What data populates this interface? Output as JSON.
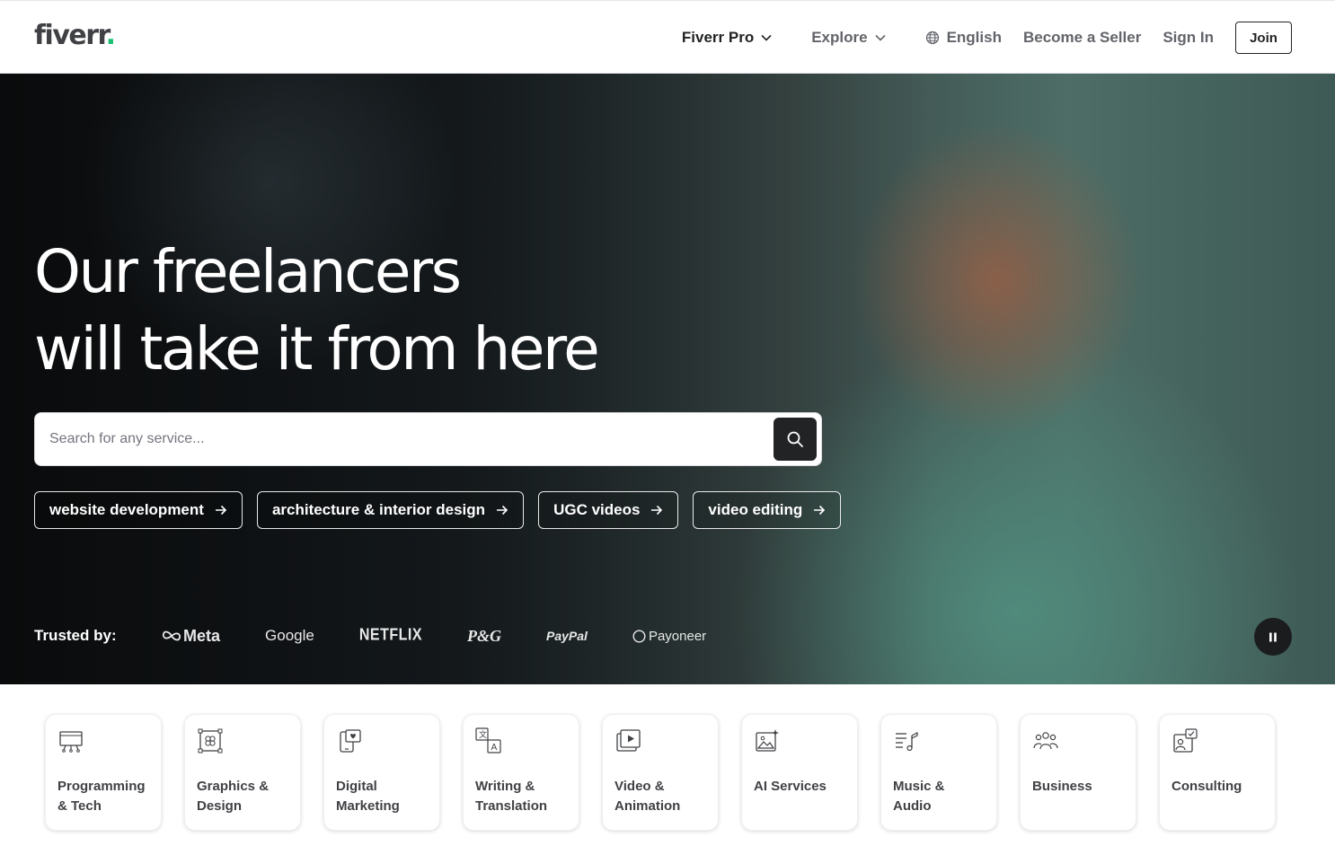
{
  "header": {
    "logo_text": "fiverr",
    "logo_dot": ".",
    "brand_color": "#1dbf73",
    "nav": {
      "fiverr_pro": "Fiverr Pro",
      "explore": "Explore",
      "language": "English",
      "become_seller": "Become a Seller",
      "sign_in": "Sign In",
      "join": "Join"
    }
  },
  "hero": {
    "title_line1": "Our freelancers",
    "title_line2": "will take it from here",
    "search": {
      "placeholder": "Search for any service..."
    },
    "chips": [
      {
        "label": "website development"
      },
      {
        "label": "architecture & interior design"
      },
      {
        "label": "UGC videos"
      },
      {
        "label": "video editing"
      }
    ],
    "trusted": {
      "label": "Trusted by:",
      "brands": [
        "Meta",
        "Google",
        "NETFLIX",
        "P&G",
        "PayPal",
        "Payoneer"
      ]
    }
  },
  "categories": [
    {
      "label": "Programming\n& Tech",
      "icon": "monitor-icon"
    },
    {
      "label": "Graphics &\nDesign",
      "icon": "design-icon"
    },
    {
      "label": "Digital\nMarketing",
      "icon": "marketing-icon"
    },
    {
      "label": "Writing &\nTranslation",
      "icon": "translation-icon"
    },
    {
      "label": "Video &\nAnimation",
      "icon": "video-icon"
    },
    {
      "label": "AI Services",
      "icon": "ai-image-icon"
    },
    {
      "label": "Music & Audio",
      "icon": "music-icon"
    },
    {
      "label": "Business",
      "icon": "people-icon"
    },
    {
      "label": "Consulting",
      "icon": "consulting-icon"
    }
  ]
}
